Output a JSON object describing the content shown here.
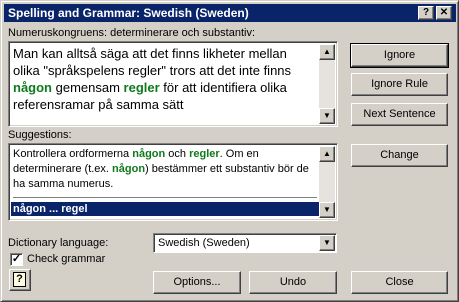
{
  "window": {
    "title": "Spelling and Grammar: Swedish (Sweden)",
    "help_button": "?",
    "close_button": "✕"
  },
  "problem": {
    "label": "Numeruskongruens: determinerare och substantiv:",
    "sentence": {
      "part1": "Man kan alltså säga att det finns likheter mellan olika \"språkspelens regler\" trors att det inte finns ",
      "word1": "någon",
      "part2": " gemensam ",
      "word2": "regler",
      "part3": " för att identifiera olika referensramar på samma sätt"
    }
  },
  "suggestions": {
    "label": "Suggestions:",
    "text": {
      "part1": "Kontrollera ordformerna ",
      "word1": "någon",
      "part2": " och ",
      "word2": "regler",
      "part3": ". Om en determinerare (t.ex. ",
      "word3": "någon",
      "part4": ") bestämmer ett substantiv bör de ha samma numerus."
    },
    "selected": "någon ... regel"
  },
  "buttons": {
    "ignore": "Ignore",
    "ignore_rule": "Ignore Rule",
    "next_sentence": "Next Sentence",
    "change": "Change",
    "options": "Options...",
    "undo": "Undo",
    "close": "Close"
  },
  "dictionary": {
    "label": "Dictionary language:",
    "value": "Swedish (Sweden)"
  },
  "check_grammar": {
    "label": "Check grammar",
    "checked": true
  },
  "office_assistant_button": "?",
  "colors": {
    "title_bar": "#0a246a",
    "highlight_word": "#0f7a1c",
    "dialog_face": "#d4d0c8"
  }
}
